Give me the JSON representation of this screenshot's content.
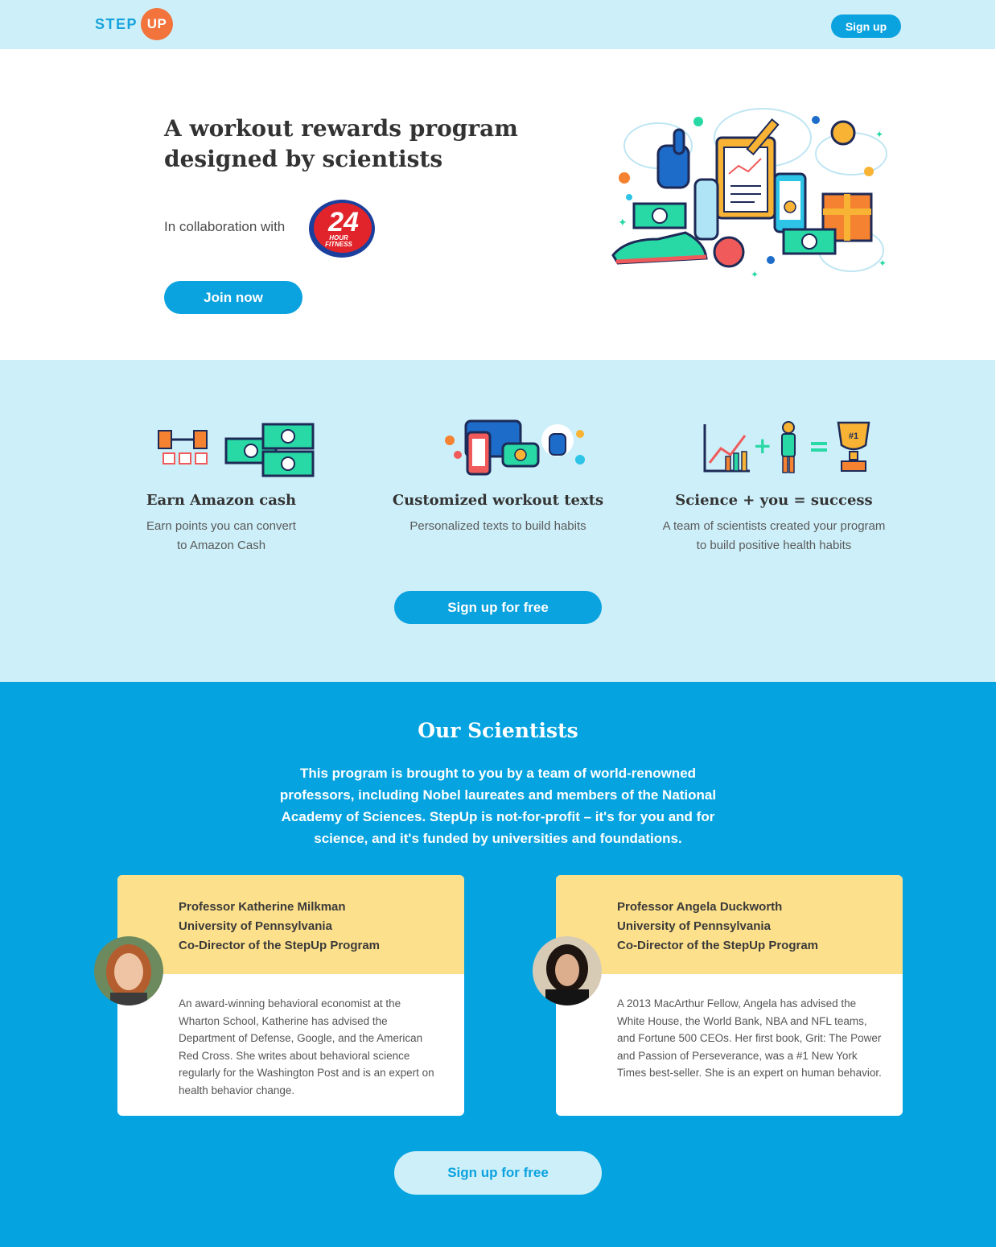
{
  "header": {
    "logo_step": "STEP",
    "logo_up": "UP",
    "signup_label": "Sign up"
  },
  "hero": {
    "title": "A workout rewards program designed by scientists",
    "collab_text": "In collaboration with",
    "partner_logo_text": "24 HOUR FITNESS",
    "join_label": "Join now"
  },
  "features": {
    "items": [
      {
        "title": "Earn Amazon cash",
        "desc_line1": "Earn points you can convert",
        "desc_line2": "to Amazon Cash"
      },
      {
        "title": "Customized workout texts",
        "desc_line1": "Personalized texts to build habits",
        "desc_line2": ""
      },
      {
        "title": "Science + you = success",
        "desc_line1": "A team of scientists created your program",
        "desc_line2": "to build positive health habits"
      }
    ],
    "cta_label": "Sign up for free"
  },
  "scientists": {
    "title": "Our Scientists",
    "intro": "This program is brought to you by a team of world-renowned professors, including Nobel laureates and members of the National Academy of Sciences. StepUp is not-for-profit – it's for you and for science, and it's funded by universities and foundations.",
    "cards": [
      {
        "name": "Professor Katherine Milkman",
        "university": "University of Pennsylvania",
        "role": "Co-Director of the StepUp Program",
        "bio": "An award-winning behavioral economist at the Wharton School, Katherine has advised the Department of Defense, Google, and the American Red Cross. She writes about behavioral science regularly for the Washington Post and is an expert on health behavior change."
      },
      {
        "name": "Professor Angela Duckworth",
        "university": "University of Pennsylvania",
        "role": "Co-Director of the StepUp Program",
        "bio": "A 2013 MacArthur Fellow, Angela has advised the White House, the World Bank, NBA and NFL teams, and Fortune 500 CEOs. Her first book, Grit: The Power and Passion of Perseverance, was a #1 New York Times best-seller. She is an expert on human behavior."
      }
    ],
    "cta_label": "Sign up for free"
  },
  "colors": {
    "brand_blue": "#0aa2df",
    "light_blue": "#cdeff9",
    "section_blue": "#05a3e0",
    "card_yellow": "#fde08b",
    "logo_orange": "#f2733b"
  }
}
